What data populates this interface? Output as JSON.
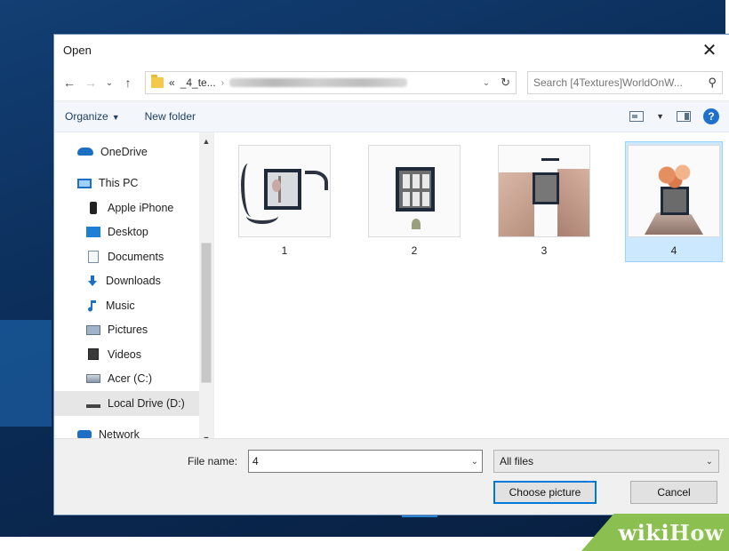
{
  "dialog": {
    "title": "Open",
    "close_glyph": "✕"
  },
  "nav_buttons": {
    "back": "←",
    "forward": "→",
    "recent": "⌄",
    "up": "↑"
  },
  "address": {
    "prefix": "«",
    "crumb": "_4_te...",
    "separator": "›"
  },
  "search": {
    "placeholder": "Search [4Textures]WorldOnW..."
  },
  "toolbar": {
    "organize": "Organize",
    "new_folder": "New folder",
    "help": "?"
  },
  "sidebar": {
    "items": [
      {
        "label": "OneDrive",
        "icon": "onedrive-icon"
      },
      {
        "label": "This PC",
        "icon": "computer-icon"
      },
      {
        "label": "Apple iPhone",
        "icon": "phone-icon"
      },
      {
        "label": "Desktop",
        "icon": "desktop-icon"
      },
      {
        "label": "Documents",
        "icon": "documents-icon"
      },
      {
        "label": "Downloads",
        "icon": "downloads-icon"
      },
      {
        "label": "Music",
        "icon": "music-icon"
      },
      {
        "label": "Pictures",
        "icon": "pictures-icon"
      },
      {
        "label": "Videos",
        "icon": "videos-icon"
      },
      {
        "label": "Acer (C:)",
        "icon": "drive-icon"
      },
      {
        "label": "Local Drive (D:)",
        "icon": "local-drive-icon"
      },
      {
        "label": "Network",
        "icon": "network-icon"
      }
    ],
    "selected": "Local Drive (D:)"
  },
  "files": [
    {
      "name": "1",
      "selected": false
    },
    {
      "name": "2",
      "selected": false
    },
    {
      "name": "3",
      "selected": false
    },
    {
      "name": "4",
      "selected": true
    }
  ],
  "footer": {
    "file_name_label": "File name:",
    "file_name_value": "4",
    "file_type_value": "All files",
    "choose_button": "Choose picture",
    "cancel_button": "Cancel"
  },
  "watermark": {
    "wiki": "wiki",
    "how": "How"
  },
  "colors": {
    "accent": "#0078d7",
    "selection": "#cce8ff",
    "wallpaper": "#0b2c57",
    "watermark": "#8bbf4f"
  }
}
